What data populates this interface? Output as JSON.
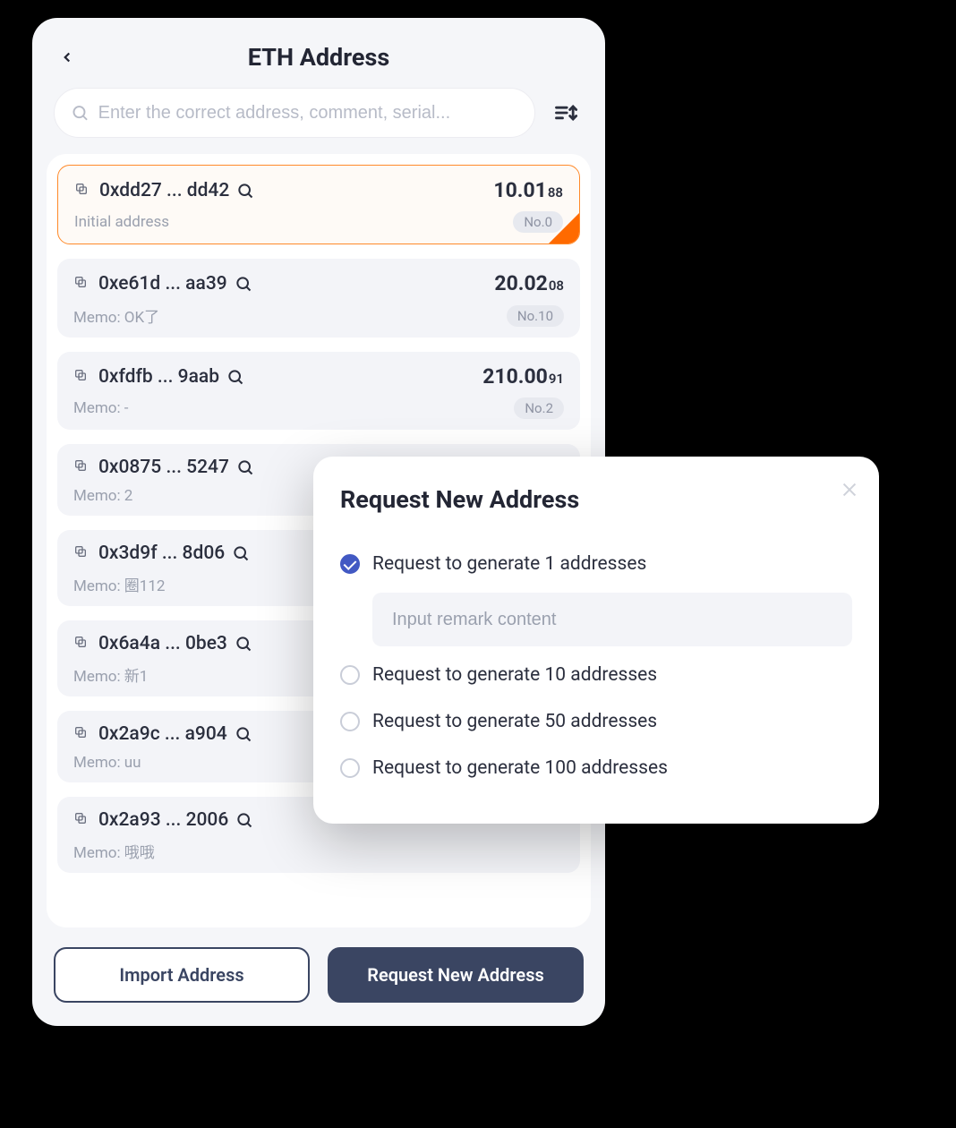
{
  "header": {
    "title": "ETH Address"
  },
  "search": {
    "placeholder": "Enter the correct address, comment, serial..."
  },
  "addresses": [
    {
      "addr": "0xdd27 ... dd42",
      "memo": "Initial address",
      "balance_main": "10.01",
      "balance_sub": "88",
      "badge": "No.0",
      "selected": true,
      "memo_prefix": ""
    },
    {
      "addr": "0xe61d ... aa39",
      "memo": "OK了",
      "balance_main": "20.02",
      "balance_sub": "08",
      "badge": "No.10",
      "selected": false,
      "memo_prefix": "Memo: "
    },
    {
      "addr": "0xfdfb ... 9aab",
      "memo": "-",
      "balance_main": "210.00",
      "balance_sub": "91",
      "badge": "No.2",
      "selected": false,
      "memo_prefix": "Memo: "
    },
    {
      "addr": "0x0875 ... 5247",
      "memo": "2",
      "balance_main": "",
      "balance_sub": "",
      "badge": "",
      "selected": false,
      "memo_prefix": "Memo: "
    },
    {
      "addr": "0x3d9f ... 8d06",
      "memo": "圈112",
      "balance_main": "",
      "balance_sub": "",
      "badge": "",
      "selected": false,
      "memo_prefix": "Memo: "
    },
    {
      "addr": "0x6a4a ... 0be3",
      "memo": "新1",
      "balance_main": "",
      "balance_sub": "",
      "badge": "",
      "selected": false,
      "memo_prefix": "Memo: "
    },
    {
      "addr": "0x2a9c ... a904",
      "memo": "uu",
      "balance_main": "",
      "balance_sub": "",
      "badge": "",
      "selected": false,
      "memo_prefix": "Memo: "
    },
    {
      "addr": "0x2a93 ... 2006",
      "memo": "哦哦",
      "balance_main": "",
      "balance_sub": "",
      "badge": "",
      "selected": false,
      "memo_prefix": "Memo: "
    }
  ],
  "footer": {
    "import_label": "Import Address",
    "request_label": "Request New Address"
  },
  "modal": {
    "title": "Request New Address",
    "options": [
      "Request to generate 1 addresses",
      "Request to generate 10 addresses",
      "Request to generate 50 addresses",
      "Request to generate 100 addresses"
    ],
    "selected_index": 0,
    "remark_placeholder": "Input remark content"
  }
}
